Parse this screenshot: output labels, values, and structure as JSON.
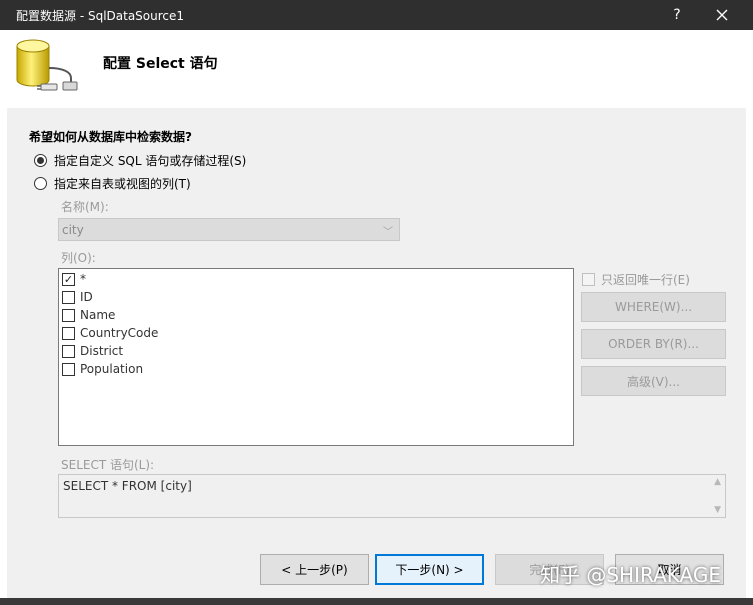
{
  "window": {
    "title": "配置数据源 - SqlDataSource1",
    "help_label": "?",
    "close_label": "✕"
  },
  "header": {
    "title": "配置 Select 语句"
  },
  "question": "希望如何从数据库中检索数据?",
  "options": {
    "custom_sql": "指定自定义 SQL 语句或存储过程(S)",
    "table_columns": "指定来自表或视图的列(T)",
    "custom_sql_selected": true
  },
  "name_label": "名称(M):",
  "name_value": "city",
  "columns_label": "列(O):",
  "columns": [
    {
      "label": "*",
      "checked": true
    },
    {
      "label": "ID",
      "checked": false
    },
    {
      "label": "Name",
      "checked": false
    },
    {
      "label": "CountryCode",
      "checked": false
    },
    {
      "label": "District",
      "checked": false
    },
    {
      "label": "Population",
      "checked": false
    }
  ],
  "unique_rows_label": "只返回唯一行(E)",
  "side_buttons": {
    "where": "WHERE(W)...",
    "order_by": "ORDER BY(R)...",
    "advanced": "高级(V)..."
  },
  "select_label": "SELECT 语句(L):",
  "select_statement": "SELECT * FROM [city]",
  "footer": {
    "prev": "< 上一步(P)",
    "next": "下一步(N) >",
    "finish": "完成(F)",
    "cancel": "取消"
  },
  "watermark": "知乎 @SHIRAKAGE",
  "colors": {
    "titlebar": "#2f2f2f",
    "panel": "#f0f0f0",
    "accent": "#0078d7"
  }
}
